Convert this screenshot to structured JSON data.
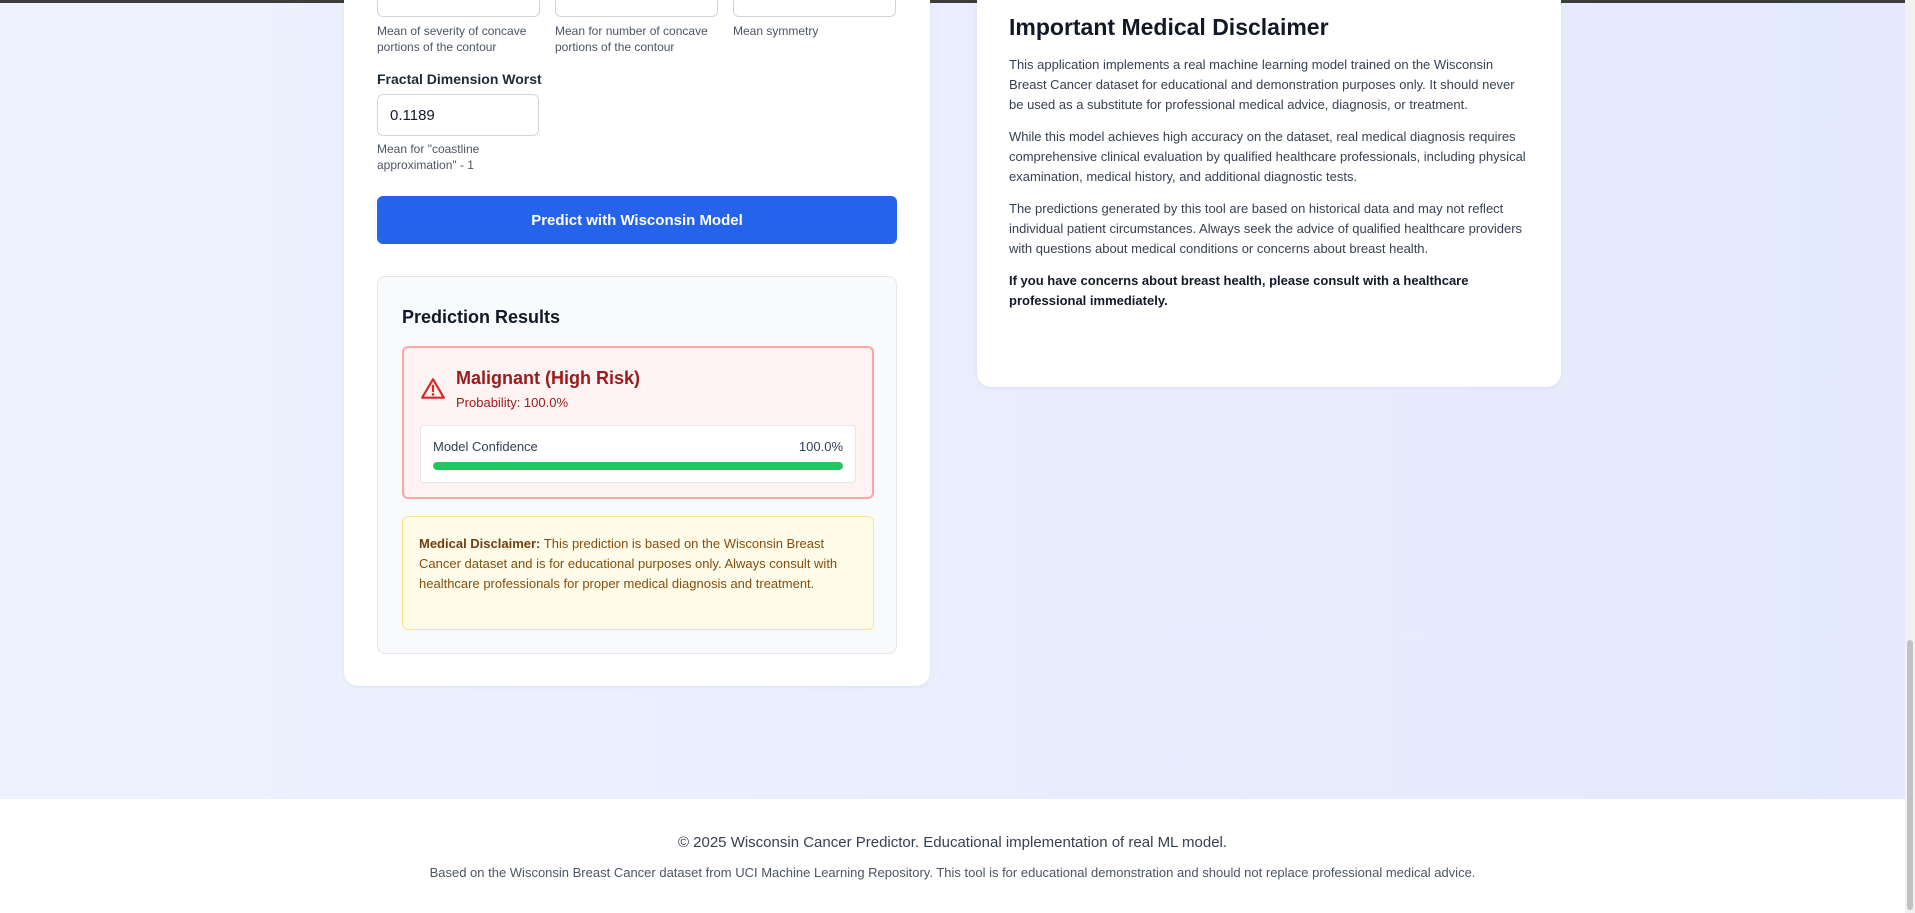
{
  "form": {
    "hints_top": [
      "Mean of severity of concave portions of the contour",
      "Mean for number of concave portions of the contour",
      "Mean symmetry"
    ],
    "fractal_label": "Fractal Dimension Worst",
    "fractal_value": "0.1189",
    "fractal_hint": "Mean for \"coastline approximation\" - 1",
    "predict_button": "Predict with Wisconsin Model"
  },
  "results": {
    "title": "Prediction Results",
    "risk_title": "Malignant (High Risk)",
    "probability": "Probability: 100.0%",
    "confidence_label": "Model Confidence",
    "confidence_value": "100.0%",
    "confidence_fraction": 1.0,
    "disclaimer_strong": "Medical Disclaimer:",
    "disclaimer_text": " This prediction is based on the Wisconsin Breast Cancer dataset and is for educational purposes only. Always consult with healthcare professionals for proper medical diagnosis and treatment."
  },
  "disclaimer_panel": {
    "title": "Important Medical Disclaimer",
    "paragraphs": [
      "This application implements a real machine learning model trained on the Wisconsin Breast Cancer dataset for educational and demonstration purposes only. It should never be used as a substitute for professional medical advice, diagnosis, or treatment.",
      "While this model achieves high accuracy on the dataset, real medical diagnosis requires comprehensive clinical evaluation by qualified healthcare professionals, including physical examination, medical history, and additional diagnostic tests.",
      "The predictions generated by this tool are based on historical data and may not reflect individual patient circumstances. Always seek the advice of qualified healthcare providers with questions about medical conditions or concerns about breast health."
    ],
    "emphasis": "If you have concerns about breast health, please consult with a healthcare professional immediately."
  },
  "footer": {
    "main": "© 2025 Wisconsin Cancer Predictor. Educational implementation of real ML model.",
    "sub": "Based on the Wisconsin Breast Cancer dataset from UCI Machine Learning Repository. This tool is for educational demonstration and should not replace professional medical advice."
  },
  "colors": {
    "accent": "#2563eb",
    "danger": "#991b1b",
    "success": "#22c55e",
    "warning_bg": "#fefce8"
  },
  "icons": {
    "risk": "warning-triangle-icon"
  }
}
